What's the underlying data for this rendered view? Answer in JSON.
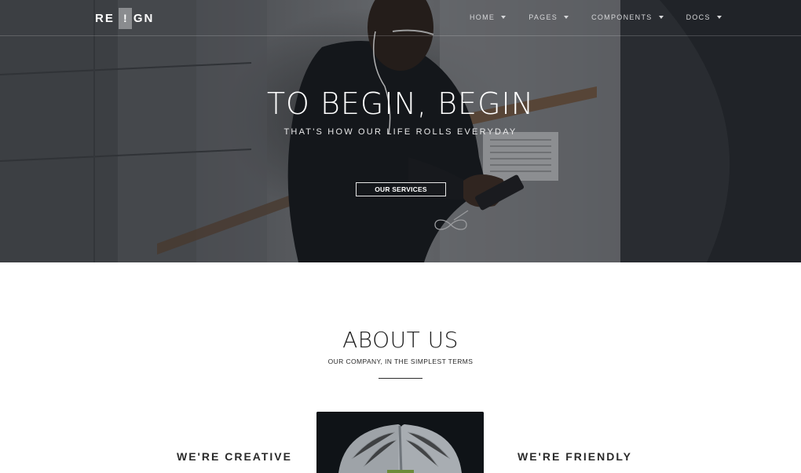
{
  "brand": {
    "left": "RE",
    "mark": "!",
    "right": "GN"
  },
  "nav": {
    "items": [
      {
        "label": "HOME"
      },
      {
        "label": "PAGES"
      },
      {
        "label": "COMPONENTS"
      },
      {
        "label": "DOCS"
      }
    ]
  },
  "hero": {
    "title": "TO BEGIN, BEGIN",
    "subtitle": "THAT'S HOW OUR LIFE ROLLS EVERYDAY",
    "button_label": "OUR SERVICES"
  },
  "about": {
    "title": "ABOUT US",
    "subtitle": "OUR COMPANY, IN THE SIMPLEST TERMS",
    "feature_left": "WE'RE CREATIVE",
    "feature_right": "WE'RE FRIENDLY"
  },
  "colors": {
    "accent_mark": "#8a8c8f",
    "text_dark": "#1c1c1c",
    "hero_overlay": "#14161c"
  },
  "icons": {
    "nav_dropdown": "caret-down-icon",
    "scroll_hint": "infinity-scroll-icon"
  }
}
